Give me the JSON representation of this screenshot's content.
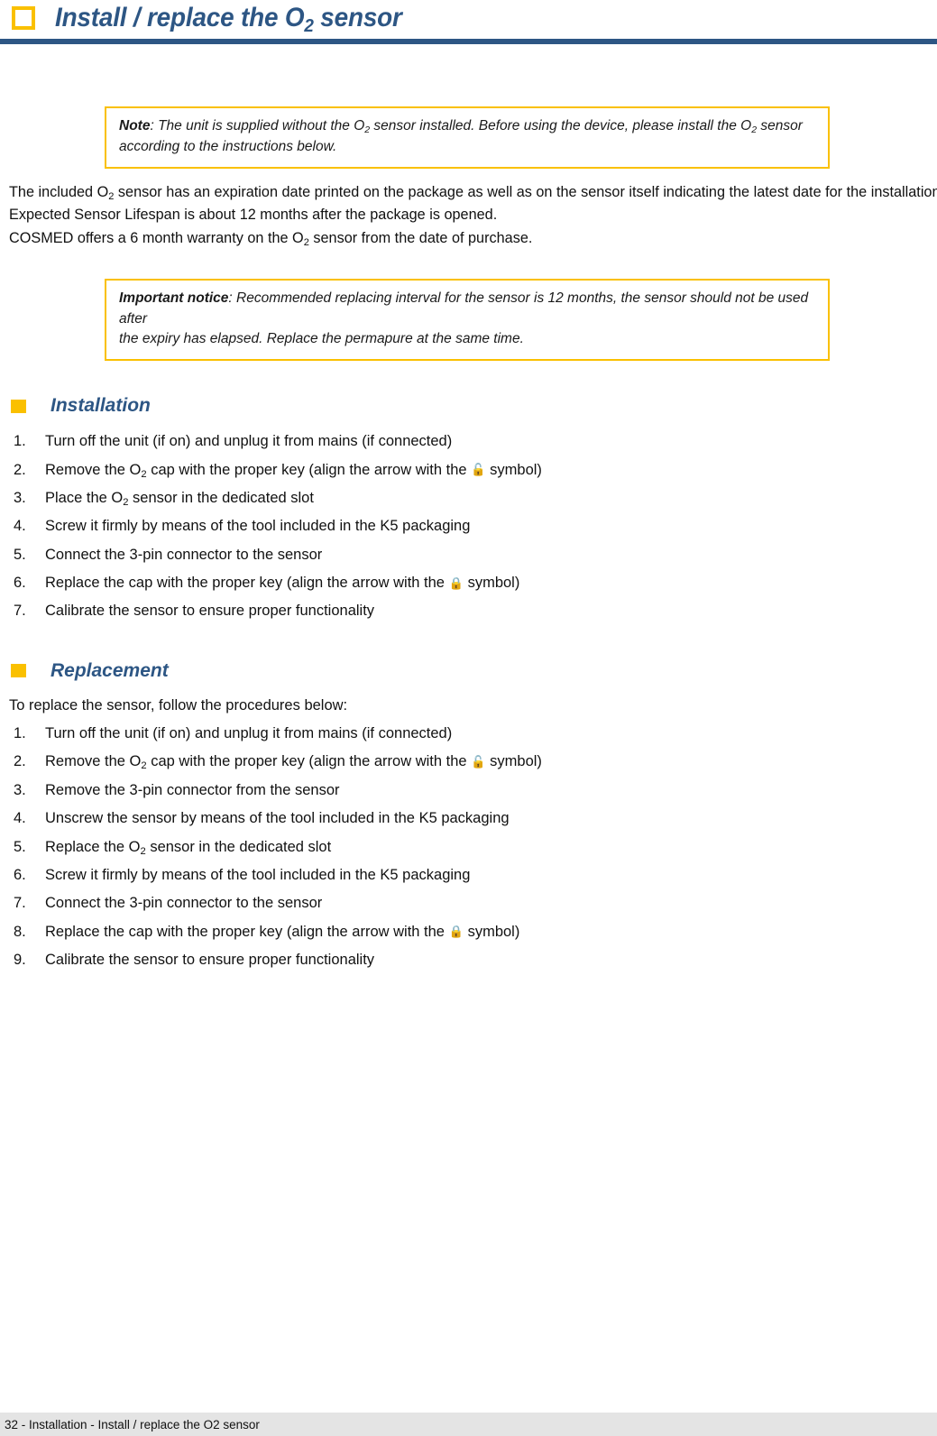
{
  "header": {
    "icon": "square-outline-icon",
    "title_parts": {
      "before": "Install / replace the O",
      "sub": "2",
      "after": " sensor"
    },
    "accent_color": "#FAC000",
    "title_color": "#2D5684"
  },
  "note_callout": {
    "lead": "Note",
    "line1_a": ": The unit is supplied without the O",
    "line1_sub1": "2",
    "line1_b": " sensor installed. Before using the device, please install the O",
    "line1_sub2": "2",
    "line1_c": " sensor",
    "line2": "according to the instructions below.",
    "border_color": "#FAC000"
  },
  "body": {
    "p1_a": "The included O",
    "p1_sub": "2",
    "p1_b": " sensor has an expiration date printed on the package as well as on the sensor itself indicating the latest date for the installation.",
    "p2": "Expected Sensor Lifespan is about 12 months after the package is opened.",
    "p3_a": "COSMED offers a 6 month warranty on the O",
    "p3_sub": "2",
    "p3_b": " sensor from the date of purchase."
  },
  "important_callout": {
    "lead": "Important notice",
    "line1": ": Recommended replacing interval for the sensor is 12 months, the sensor should not be used after",
    "line2": "the expiry has elapsed. Replace the permapure at the same time.",
    "border_color": "#FAC000"
  },
  "installation_section": {
    "bullet": "square-filled-icon",
    "title": "Installation",
    "steps": [
      {
        "num": "1.",
        "text_a": "Turn off the unit (if on) and unplug it from mains (if connected)",
        "sub": "",
        "text_b": "",
        "icon": "",
        "text_c": ""
      },
      {
        "num": "2.",
        "text_a": "Remove the O",
        "sub": "2",
        "text_b": " cap with the proper key (align the arrow with the ",
        "icon": "unlock-icon",
        "text_c": " symbol)"
      },
      {
        "num": "3.",
        "text_a": "Place the O",
        "sub": "2",
        "text_b": " sensor in the dedicated slot",
        "icon": "",
        "text_c": ""
      },
      {
        "num": "4.",
        "text_a": "Screw it firmly by means of the tool included in the K5 packaging",
        "sub": "",
        "text_b": "",
        "icon": "",
        "text_c": ""
      },
      {
        "num": "5.",
        "text_a": "Connect the 3-pin connector to the sensor",
        "sub": "",
        "text_b": "",
        "icon": "",
        "text_c": ""
      },
      {
        "num": "6.",
        "text_a": "Replace the cap with the proper key (align the arrow with the ",
        "sub": "",
        "text_b": "",
        "icon": "lock-icon",
        "text_c": " symbol)"
      },
      {
        "num": "7.",
        "text_a": "Calibrate the sensor to ensure proper functionality",
        "sub": "",
        "text_b": "",
        "icon": "",
        "text_c": ""
      }
    ]
  },
  "replacement_section": {
    "bullet": "square-filled-icon",
    "title": "Replacement",
    "intro": "To replace the sensor, follow the procedures below:",
    "steps": [
      {
        "num": "1.",
        "text_a": "Turn off the unit (if on) and unplug it from mains (if connected)",
        "sub": "",
        "text_b": "",
        "icon": "",
        "text_c": ""
      },
      {
        "num": "2.",
        "text_a": "Remove the O",
        "sub": "2",
        "text_b": " cap with the proper key (align the arrow with the ",
        "icon": "unlock-icon",
        "text_c": " symbol)"
      },
      {
        "num": "3.",
        "text_a": "Remove the 3-pin connector from the sensor",
        "sub": "",
        "text_b": "",
        "icon": "",
        "text_c": ""
      },
      {
        "num": "4.",
        "text_a": "Unscrew the sensor by means of the tool included in the K5 packaging",
        "sub": "",
        "text_b": "",
        "icon": "",
        "text_c": ""
      },
      {
        "num": "5.",
        "text_a": "Replace the O",
        "sub": "2",
        "text_b": " sensor in the dedicated slot",
        "icon": "",
        "text_c": ""
      },
      {
        "num": "6.",
        "text_a": "Screw it firmly by means of the tool included in the K5 packaging",
        "sub": "",
        "text_b": "",
        "icon": "",
        "text_c": ""
      },
      {
        "num": "7.",
        "text_a": "Connect the 3-pin connector to the sensor",
        "sub": "",
        "text_b": "",
        "icon": "",
        "text_c": ""
      },
      {
        "num": "8.",
        "text_a": "Replace the cap with the proper key (align the arrow with the ",
        "sub": "",
        "text_b": "",
        "icon": "lock-icon",
        "text_c": " symbol)"
      },
      {
        "num": "9.",
        "text_a": "Calibrate the sensor to ensure proper functionality",
        "sub": "",
        "text_b": "",
        "icon": "",
        "text_c": ""
      }
    ]
  },
  "footer": {
    "text": "32 - Installation - Install / replace the O2 sensor",
    "background_color": "#E4E4E4"
  }
}
